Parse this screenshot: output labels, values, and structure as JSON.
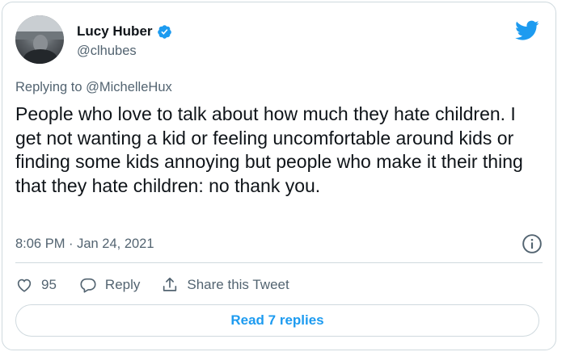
{
  "author": {
    "display_name": "Lucy Huber",
    "handle": "@clhubes",
    "verified": true
  },
  "tweet": {
    "replying_to": "Replying to @MichelleHux",
    "text": "People who love to talk about how much they hate children. I get not wanting a kid or feeling uncomfortable around kids or finding some kids annoying but people who make it their thing that they hate children: no thank you.",
    "timestamp": "8:06 PM · Jan 24, 2021"
  },
  "actions": {
    "like_count": "95",
    "reply_label": "Reply",
    "share_label": "Share this Tweet"
  },
  "read_replies_label": "Read 7 replies",
  "colors": {
    "accent": "#1d9bf0",
    "secondary_text": "#536471",
    "border": "#cfd9de"
  },
  "icons": [
    "avatar",
    "verified-badge-icon",
    "twitter-bird-icon",
    "info-icon",
    "heart-icon",
    "reply-icon",
    "share-icon"
  ]
}
